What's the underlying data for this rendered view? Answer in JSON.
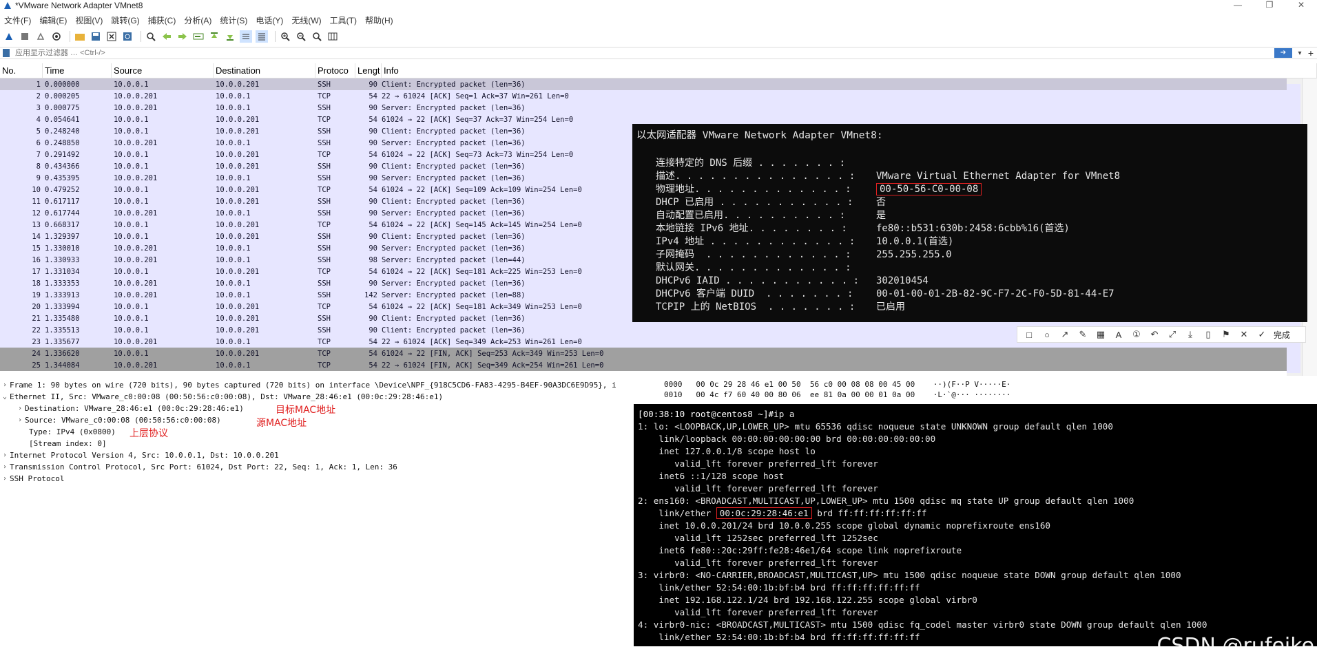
{
  "window": {
    "title": "*VMware Network Adapter VMnet8",
    "controls": [
      "—",
      "❐",
      "✕"
    ]
  },
  "menu": [
    "文件(F)",
    "编辑(E)",
    "视图(V)",
    "跳转(G)",
    "捕获(C)",
    "分析(A)",
    "统计(S)",
    "电话(Y)",
    "无线(W)",
    "工具(T)",
    "帮助(H)"
  ],
  "filter": {
    "placeholder": "应用显示过滤器 … <Ctrl-/>"
  },
  "packet_list": {
    "columns": [
      "No.",
      "Time",
      "Source",
      "Destination",
      "Protoco",
      "Lengt",
      "Info"
    ],
    "rows": [
      {
        "no": "1",
        "time": "0.000000",
        "src": "10.0.0.1",
        "dst": "10.0.0.201",
        "proto": "SSH",
        "len": "90",
        "info": "Client: Encrypted packet (len=36)",
        "style": "sel"
      },
      {
        "no": "2",
        "time": "0.000205",
        "src": "10.0.0.201",
        "dst": "10.0.0.1",
        "proto": "TCP",
        "len": "54",
        "info": "22 → 61024 [ACK] Seq=1 Ack=37 Win=261 Len=0",
        "style": ""
      },
      {
        "no": "3",
        "time": "0.000775",
        "src": "10.0.0.201",
        "dst": "10.0.0.1",
        "proto": "SSH",
        "len": "90",
        "info": "Server: Encrypted packet (len=36)",
        "style": ""
      },
      {
        "no": "4",
        "time": "0.054641",
        "src": "10.0.0.1",
        "dst": "10.0.0.201",
        "proto": "TCP",
        "len": "54",
        "info": "61024 → 22 [ACK] Seq=37 Ack=37 Win=254 Len=0",
        "style": ""
      },
      {
        "no": "5",
        "time": "0.248240",
        "src": "10.0.0.1",
        "dst": "10.0.0.201",
        "proto": "SSH",
        "len": "90",
        "info": "Client: Encrypted packet (len=36)",
        "style": ""
      },
      {
        "no": "6",
        "time": "0.248850",
        "src": "10.0.0.201",
        "dst": "10.0.0.1",
        "proto": "SSH",
        "len": "90",
        "info": "Server: Encrypted packet (len=36)",
        "style": ""
      },
      {
        "no": "7",
        "time": "0.291492",
        "src": "10.0.0.1",
        "dst": "10.0.0.201",
        "proto": "TCP",
        "len": "54",
        "info": "61024 → 22 [ACK] Seq=73 Ack=73 Win=254 Len=0",
        "style": ""
      },
      {
        "no": "8",
        "time": "0.434366",
        "src": "10.0.0.1",
        "dst": "10.0.0.201",
        "proto": "SSH",
        "len": "90",
        "info": "Client: Encrypted packet (len=36)",
        "style": ""
      },
      {
        "no": "9",
        "time": "0.435395",
        "src": "10.0.0.201",
        "dst": "10.0.0.1",
        "proto": "SSH",
        "len": "90",
        "info": "Server: Encrypted packet (len=36)",
        "style": ""
      },
      {
        "no": "10",
        "time": "0.479252",
        "src": "10.0.0.1",
        "dst": "10.0.0.201",
        "proto": "TCP",
        "len": "54",
        "info": "61024 → 22 [ACK] Seq=109 Ack=109 Win=254 Len=0",
        "style": ""
      },
      {
        "no": "11",
        "time": "0.617117",
        "src": "10.0.0.1",
        "dst": "10.0.0.201",
        "proto": "SSH",
        "len": "90",
        "info": "Client: Encrypted packet (len=36)",
        "style": ""
      },
      {
        "no": "12",
        "time": "0.617744",
        "src": "10.0.0.201",
        "dst": "10.0.0.1",
        "proto": "SSH",
        "len": "90",
        "info": "Server: Encrypted packet (len=36)",
        "style": ""
      },
      {
        "no": "13",
        "time": "0.668317",
        "src": "10.0.0.1",
        "dst": "10.0.0.201",
        "proto": "TCP",
        "len": "54",
        "info": "61024 → 22 [ACK] Seq=145 Ack=145 Win=254 Len=0",
        "style": ""
      },
      {
        "no": "14",
        "time": "1.329397",
        "src": "10.0.0.1",
        "dst": "10.0.0.201",
        "proto": "SSH",
        "len": "90",
        "info": "Client: Encrypted packet (len=36)",
        "style": ""
      },
      {
        "no": "15",
        "time": "1.330010",
        "src": "10.0.0.201",
        "dst": "10.0.0.1",
        "proto": "SSH",
        "len": "90",
        "info": "Server: Encrypted packet (len=36)",
        "style": ""
      },
      {
        "no": "16",
        "time": "1.330933",
        "src": "10.0.0.201",
        "dst": "10.0.0.1",
        "proto": "SSH",
        "len": "98",
        "info": "Server: Encrypted packet (len=44)",
        "style": ""
      },
      {
        "no": "17",
        "time": "1.331034",
        "src": "10.0.0.1",
        "dst": "10.0.0.201",
        "proto": "TCP",
        "len": "54",
        "info": "61024 → 22 [ACK] Seq=181 Ack=225 Win=253 Len=0",
        "style": ""
      },
      {
        "no": "18",
        "time": "1.333353",
        "src": "10.0.0.201",
        "dst": "10.0.0.1",
        "proto": "SSH",
        "len": "90",
        "info": "Server: Encrypted packet (len=36)",
        "style": ""
      },
      {
        "no": "19",
        "time": "1.333913",
        "src": "10.0.0.201",
        "dst": "10.0.0.1",
        "proto": "SSH",
        "len": "142",
        "info": "Server: Encrypted packet (len=88)",
        "style": ""
      },
      {
        "no": "20",
        "time": "1.333994",
        "src": "10.0.0.1",
        "dst": "10.0.0.201",
        "proto": "TCP",
        "len": "54",
        "info": "61024 → 22 [ACK] Seq=181 Ack=349 Win=253 Len=0",
        "style": ""
      },
      {
        "no": "21",
        "time": "1.335480",
        "src": "10.0.0.1",
        "dst": "10.0.0.201",
        "proto": "SSH",
        "len": "90",
        "info": "Client: Encrypted packet (len=36)",
        "style": ""
      },
      {
        "no": "22",
        "time": "1.335513",
        "src": "10.0.0.1",
        "dst": "10.0.0.201",
        "proto": "SSH",
        "len": "90",
        "info": "Client: Encrypted packet (len=36)",
        "style": ""
      },
      {
        "no": "23",
        "time": "1.335677",
        "src": "10.0.0.201",
        "dst": "10.0.0.1",
        "proto": "TCP",
        "len": "54",
        "info": "22 → 61024 [ACK] Seq=349 Ack=253 Win=261 Len=0",
        "style": ""
      },
      {
        "no": "24",
        "time": "1.336620",
        "src": "10.0.0.1",
        "dst": "10.0.0.201",
        "proto": "TCP",
        "len": "54",
        "info": "61024 → 22 [FIN, ACK] Seq=253 Ack=349 Win=253 Len=0",
        "style": "fin"
      },
      {
        "no": "25",
        "time": "1.344084",
        "src": "10.0.0.201",
        "dst": "10.0.0.1",
        "proto": "TCP",
        "len": "54",
        "info": "22 → 61024 [FIN, ACK] Seq=349 Ack=254 Win=261 Len=0",
        "style": "fin"
      }
    ]
  },
  "details": {
    "frame": "Frame 1: 90 bytes on wire (720 bits), 90 bytes captured (720 bits) on interface \\Device\\NPF_{918C5CD6-FA83-4295-B4EF-90A3DC6E9D95}, i",
    "ethernet": "Ethernet II, Src: VMware_c0:00:08 (00:50:56:c0:00:08), Dst: VMware_28:46:e1 (00:0c:29:28:46:e1)",
    "eth_dst": "Destination: VMware_28:46:e1 (00:0c:29:28:46:e1)",
    "eth_src": "Source: VMware_c0:00:08 (00:50:56:c0:00:08)",
    "eth_type": "Type: IPv4 (0x0800)",
    "eth_stream": "[Stream index: 0]",
    "ip": "Internet Protocol Version 4, Src: 10.0.0.1, Dst: 10.0.0.201",
    "tcp": "Transmission Control Protocol, Src Port: 61024, Dst Port: 22, Seq: 1, Ack: 1, Len: 36",
    "ssh": "SSH Protocol",
    "annotations": {
      "dst_mac": "目标MAC地址",
      "src_mac": "源MAC地址",
      "upper_proto": "上层协议"
    }
  },
  "bytes": [
    "0000   00 0c 29 28 46 e1 00 50  56 c0 00 08 08 00 45 00    ··)(F··P V·····E·",
    "0010   00 4c f7 60 40 00 80 06  ee 81 0a 00 00 01 0a 00    ·L·`@··· ········"
  ],
  "ipconfig": {
    "title": "以太网适配器 VMware Network Adapter VMnet8:",
    "rows": [
      {
        "k": "连接特定的 DNS 后缀 . . . . . . . :",
        "v": ""
      },
      {
        "k": "描述. . . . . . . . . . . . . . . :",
        "v": "VMware Virtual Ethernet Adapter for VMnet8"
      },
      {
        "k": "物理地址. . . . . . . . . . . . . :",
        "v": "00-50-56-C0-00-08"
      },
      {
        "k": "DHCP 已启用 . . . . . . . . . . . :",
        "v": "否"
      },
      {
        "k": "自动配置已启用. . . . . . . . . . :",
        "v": "是"
      },
      {
        "k": "本地链接 IPv6 地址. . . . . . . . :",
        "v": "fe80::b531:630b:2458:6cbb%16(首选)"
      },
      {
        "k": "IPv4 地址 . . . . . . . . . . . . :",
        "v": "10.0.0.1(首选)"
      },
      {
        "k": "子网掩码  . . . . . . . . . . . . :",
        "v": "255.255.255.0"
      },
      {
        "k": "默认网关. . . . . . . . . . . . . :",
        "v": ""
      },
      {
        "k": "DHCPv6 IAID . . . . . . . . . . . :",
        "v": "302010454"
      },
      {
        "k": "DHCPv6 客户端 DUID  . . . . . . . :",
        "v": "00-01-00-01-2B-82-9C-F7-2C-F0-5D-81-44-E7"
      },
      {
        "k": "TCPIP 上的 NetBIOS  . . . . . . . :",
        "v": "已启用"
      }
    ]
  },
  "ip_a": {
    "prompt": "[00:38:10 root@centos8 ~]#",
    "command": "ip a",
    "lines": [
      "1: lo: <LOOPBACK,UP,LOWER_UP> mtu 65536 qdisc noqueue state UNKNOWN group default qlen 1000",
      "    link/loopback 00:00:00:00:00:00 brd 00:00:00:00:00:00",
      "    inet 127.0.0.1/8 scope host lo",
      "       valid_lft forever preferred_lft forever",
      "    inet6 ::1/128 scope host",
      "       valid_lft forever preferred_lft forever",
      "2: ens160: <BROADCAST,MULTICAST,UP,LOWER_UP> mtu 1500 qdisc mq state UP group default qlen 1000",
      "__ETHER__",
      "    inet 10.0.0.201/24 brd 10.0.0.255 scope global dynamic noprefixroute ens160",
      "       valid_lft 1252sec preferred_lft 1252sec",
      "    inet6 fe80::20c:29ff:fe28:46e1/64 scope link noprefixroute",
      "       valid_lft forever preferred_lft forever",
      "3: virbr0: <NO-CARRIER,BROADCAST,MULTICAST,UP> mtu 1500 qdisc noqueue state DOWN group default qlen 1000",
      "    link/ether 52:54:00:1b:bf:b4 brd ff:ff:ff:ff:ff:ff",
      "    inet 192.168.122.1/24 brd 192.168.122.255 scope global virbr0",
      "       valid_lft forever preferred_lft forever",
      "4: virbr0-nic: <BROADCAST,MULTICAST> mtu 1500 qdisc fq_codel master virbr0 state DOWN group default qlen 1000",
      "    link/ether 52:54:00:1b:bf:b4 brd ff:ff:ff:ff:ff:ff"
    ],
    "ether_prefix": "    link/ether ",
    "ether_mac": "00:0c:29:28:46:e1",
    "ether_suffix": " brd ff:ff:ff:ff:ff:ff"
  },
  "capture_toolbar": {
    "done_label": "完成"
  },
  "watermark": "CSDN @rufeike",
  "colors": {
    "row_bg": "#e7e6ff",
    "selected_row": "#c9c7d8",
    "fin_row": "#a0a0a0",
    "annotation": "#e02020",
    "terminal_bg": "#0c0c0c"
  }
}
